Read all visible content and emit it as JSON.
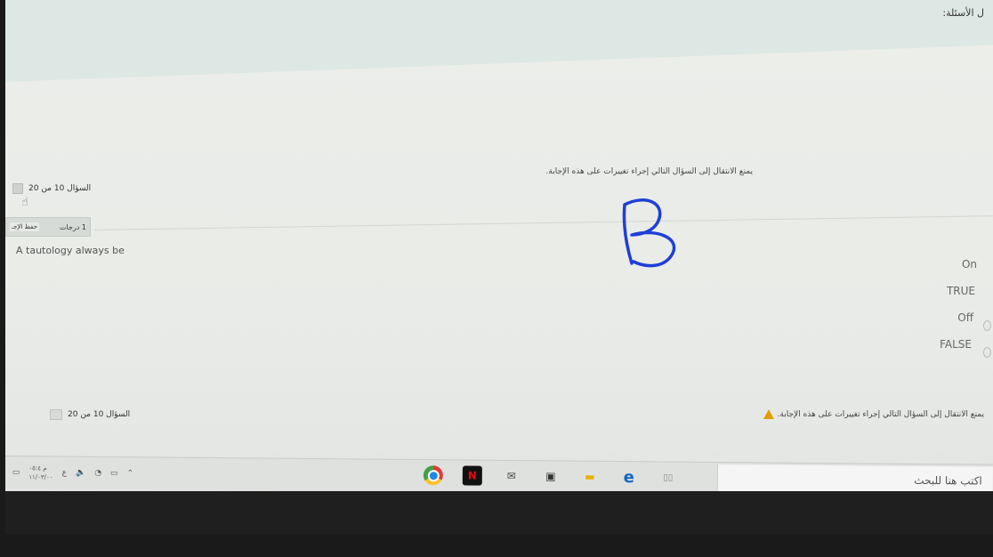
{
  "header": {
    "title": "ل الأسئلة:"
  },
  "warning_text": "يمنع الانتقال إلى السؤال التالي إجراء تغييرات على هذه الإجابة.",
  "question_nav": {
    "label": "السؤال 10 من 20"
  },
  "question_box": {
    "marks": "1 درجات",
    "flag": "حفظ الإجـ"
  },
  "question": {
    "text": "A tautology always be"
  },
  "options": [
    {
      "label": "On"
    },
    {
      "label": "TRUE"
    },
    {
      "label": "Off"
    },
    {
      "label": "FALSE"
    }
  ],
  "handwritten_mark": "B",
  "taskbar": {
    "search_placeholder": "اكتب هنا للبحث",
    "clock_time": "م ٠٥:٤",
    "clock_date": "١١/٠٣/٠٠",
    "tray_icons": [
      "notification-icon",
      "speaker-icon",
      "network-icon",
      "battery-icon",
      "chevron-up-icon"
    ],
    "apps": [
      "chrome-icon",
      "netflix-icon",
      "mail-icon",
      "store-icon",
      "file-explorer-icon",
      "edge-icon",
      "task-view-icon"
    ]
  },
  "colors": {
    "ink": "#1f3fd6",
    "warning": "#e0a000"
  }
}
